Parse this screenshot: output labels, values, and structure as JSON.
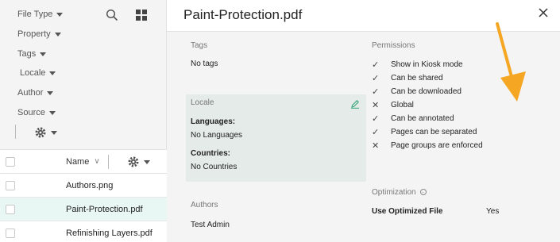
{
  "filters": {
    "file_type": "File Type",
    "property": "Property",
    "tags": "Tags",
    "locale": "Locale",
    "author": "Author",
    "source": "Source"
  },
  "list": {
    "header_name": "Name",
    "rows": [
      "Authors.png",
      "Paint-Protection.pdf",
      "Refinishing Layers.pdf"
    ]
  },
  "detail": {
    "title": "Paint-Protection.pdf",
    "tags": {
      "label": "Tags",
      "value": "No tags"
    },
    "locale": {
      "label": "Locale",
      "languages_label": "Languages:",
      "languages_value": "No Languages",
      "countries_label": "Countries:",
      "countries_value": "No Countries"
    },
    "authors": {
      "label": "Authors",
      "value": "Test Admin"
    },
    "permissions": {
      "label": "Permissions",
      "items": [
        {
          "mark": "✓",
          "label": "Show in Kiosk mode"
        },
        {
          "mark": "✓",
          "label": "Can be shared"
        },
        {
          "mark": "✓",
          "label": "Can be downloaded"
        },
        {
          "mark": "✕",
          "label": "Global"
        },
        {
          "mark": "✓",
          "label": "Can be annotated"
        },
        {
          "mark": "✓",
          "label": "Pages can be separated"
        },
        {
          "mark": "✕",
          "label": "Page groups are enforced"
        }
      ]
    },
    "optimization": {
      "label": "Optimization",
      "field_label": "Use Optimized File",
      "field_value": "Yes"
    }
  },
  "colors": {
    "accent_arrow": "#f5a623",
    "edit_icon": "#3aa57a",
    "selected_row": "#e9f7f4",
    "locale_box": "#e4ebe8"
  }
}
